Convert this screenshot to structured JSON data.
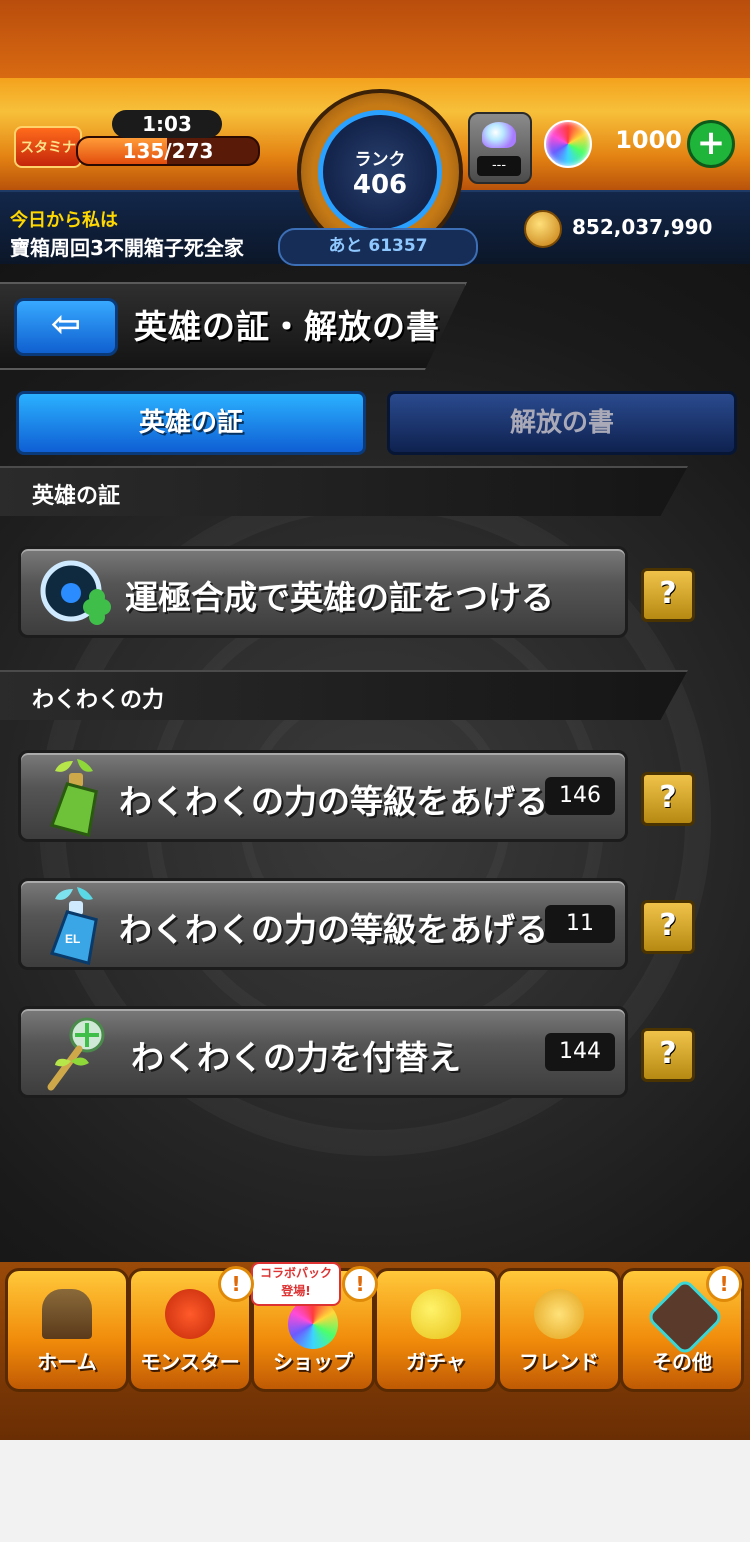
{
  "header": {
    "stamina_icon_label": "スタミナ",
    "stamina_timer": "1:03",
    "stamina_text": "135/273",
    "stamina_fraction": 0.4945,
    "rank_label": "ランク",
    "rank_value": "406",
    "next_rank_text": "あと 61357",
    "badge_slot_text": "---",
    "orb_count": "1000",
    "orb_add_symbol": "+",
    "nickname_prefix": "今日から私は",
    "nickname": "寶箱周回3不開箱子死全家",
    "coin_count": "852,037,990"
  },
  "title_bar": {
    "back_symbol": "⇦",
    "title": "英雄の証・解放の書"
  },
  "tabs": [
    {
      "label": "英雄の証",
      "active": true
    },
    {
      "label": "解放の書",
      "active": false
    }
  ],
  "sections": [
    {
      "header": "英雄の証"
    },
    {
      "header": "わくわくの力"
    }
  ],
  "menu_items": [
    {
      "label": "運極合成で英雄の証をつける",
      "count": "",
      "icon": "hero-proof-clover-icon"
    },
    {
      "label": "わくわくの力の等級をあげる",
      "count": "146",
      "icon": "green-bottle-icon"
    },
    {
      "label": "わくわくの力の等級をあげる",
      "count": "11",
      "icon": "el-blue-bottle-icon"
    },
    {
      "label": "わくわくの力を付替え",
      "count": "144",
      "icon": "sprout-wand-icon"
    }
  ],
  "help_symbol": "?",
  "nav": {
    "items": [
      {
        "label": "ホーム",
        "icon": "home-gate-icon",
        "notice": false
      },
      {
        "label": "モンスター",
        "icon": "monster-icon",
        "notice": true
      },
      {
        "label": "ショップ",
        "icon": "rainbow-orb-icon",
        "notice": true
      },
      {
        "label": "ガチャ",
        "icon": "gacha-egg-icon",
        "notice": false
      },
      {
        "label": "フレンド",
        "icon": "friend-icon",
        "notice": false
      },
      {
        "label": "その他",
        "icon": "others-icon",
        "notice": true
      }
    ],
    "collab_badge_line1": "コラボパック",
    "collab_badge_line2": "登場!",
    "notice_symbol": "!"
  },
  "colors": {
    "tab_active": "#2bb1ff",
    "tab_inactive": "#1a347a",
    "help_button": "#d6a82a",
    "nav_button": "#f7a41a"
  }
}
